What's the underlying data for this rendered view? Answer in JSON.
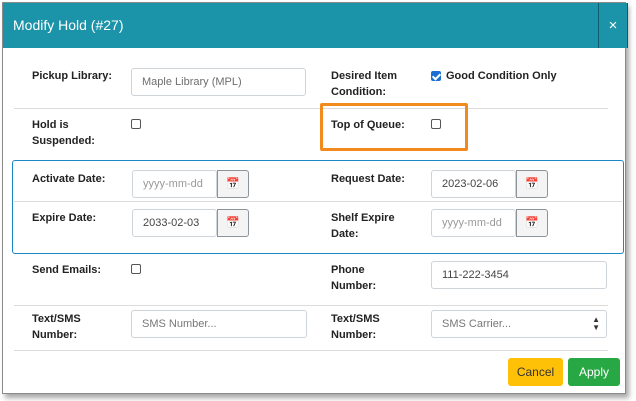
{
  "dialog": {
    "title": "Modify Hold (#27)",
    "close_symbol": "×"
  },
  "fields": {
    "pickup_library": {
      "label": "Pickup Library:",
      "value": "Maple Library (MPL)"
    },
    "desired_condition": {
      "label": "Desired Item Condition:",
      "option_label": "Good Condition Only",
      "checked": true
    },
    "hold_suspended": {
      "label": "Hold is Suspended:",
      "checked": false
    },
    "top_of_queue": {
      "label": "Top of Queue:",
      "checked": false
    },
    "activate_date": {
      "label": "Activate Date:",
      "placeholder": "yyyy-mm-dd",
      "value": ""
    },
    "request_date": {
      "label": "Request Date:",
      "value": "2023-02-06"
    },
    "expire_date": {
      "label": "Expire Date:",
      "value": "2033-02-03"
    },
    "shelf_expire_date": {
      "label": "Shelf Expire Date:",
      "placeholder": "yyyy-mm-dd",
      "value": ""
    },
    "send_emails": {
      "label": "Send Emails:",
      "checked": false
    },
    "phone_number": {
      "label": "Phone Number:",
      "value": "111-222-3454"
    },
    "sms_number": {
      "label": "Text/SMS Number:",
      "placeholder": "SMS Number..."
    },
    "sms_carrier": {
      "label": "Text/SMS Number:",
      "selected": "SMS Carrier..."
    }
  },
  "icons": {
    "calendar": "calendar-icon",
    "select_arrows": "chevron-up-down-icon"
  },
  "buttons": {
    "cancel": "Cancel",
    "apply": "Apply"
  },
  "colors": {
    "header": "#1b93a8",
    "highlight": "#f28a1e",
    "cancel": "#ffc107",
    "apply": "#28a745",
    "date_box": "#1a87c7"
  }
}
